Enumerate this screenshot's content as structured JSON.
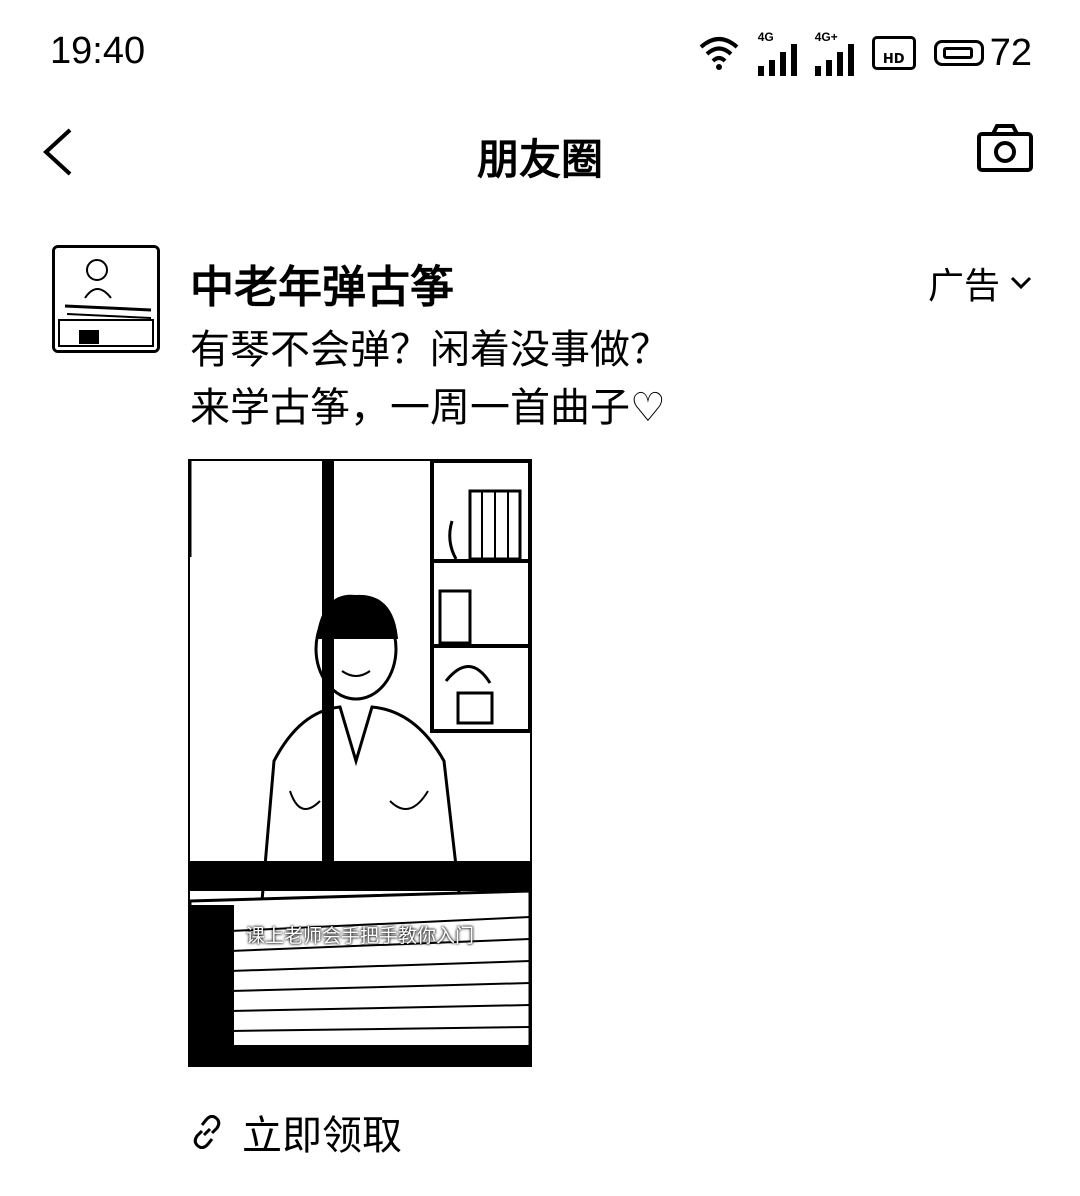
{
  "status": {
    "time": "19:40",
    "sig1_tag": "4G",
    "sig2_tag": "4G+",
    "hd_label": "HD",
    "battery_level": "72"
  },
  "nav": {
    "title": "朋友圈"
  },
  "post": {
    "author": "中老年弹古筝",
    "ad_label": "广告",
    "text_line1": "有琴不会弹？闲着没事做？",
    "text_line2": "来学古筝，一周一首曲子♡",
    "video_subtitle": "课上老师会手把手教你入门",
    "link_label": "立即领取"
  }
}
